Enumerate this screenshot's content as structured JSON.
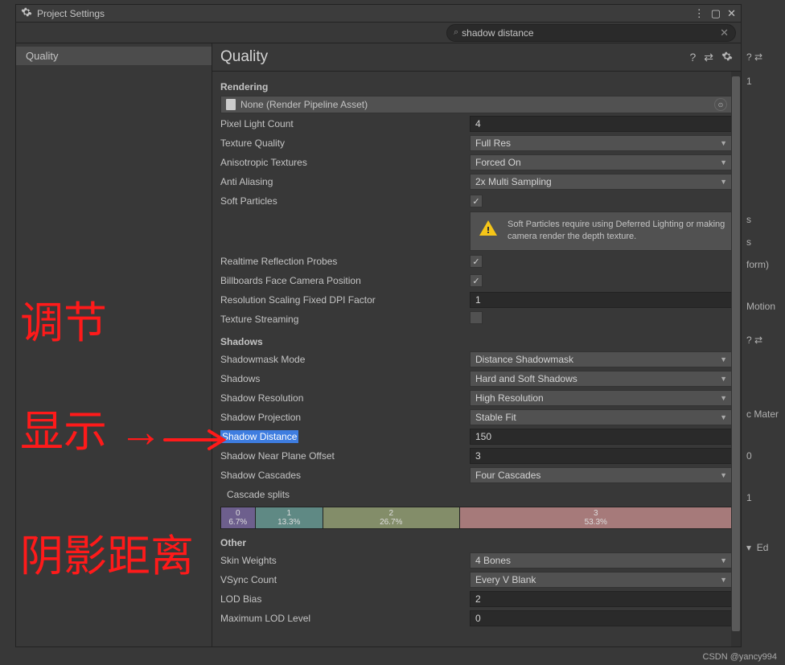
{
  "window": {
    "title": "Project Settings"
  },
  "search": {
    "placeholder": "",
    "value": "shadow distance"
  },
  "sidebar": {
    "items": [
      {
        "label": "Quality",
        "active": true
      }
    ]
  },
  "header": {
    "title": "Quality"
  },
  "sections": {
    "rendering": {
      "title": "Rendering",
      "pipeline_asset": "None (Render Pipeline Asset)",
      "pixel_light_count_label": "Pixel Light Count",
      "pixel_light_count": "4",
      "texture_quality_label": "Texture Quality",
      "texture_quality": "Full Res",
      "anisotropic_label": "Anisotropic Textures",
      "anisotropic": "Forced On",
      "antialiasing_label": "Anti Aliasing",
      "antialiasing": "2x Multi Sampling",
      "soft_particles_label": "Soft Particles",
      "soft_particles": true,
      "soft_particles_warning": "Soft Particles require using Deferred Lighting or making camera render the depth texture.",
      "realtime_probes_label": "Realtime Reflection Probes",
      "realtime_probes": true,
      "billboards_label": "Billboards Face Camera Position",
      "billboards": true,
      "resolution_scaling_label": "Resolution Scaling Fixed DPI Factor",
      "resolution_scaling": "1",
      "texture_streaming_label": "Texture Streaming",
      "texture_streaming": false
    },
    "shadows": {
      "title": "Shadows",
      "shadowmask_mode_label": "Shadowmask Mode",
      "shadowmask_mode": "Distance Shadowmask",
      "shadows_label": "Shadows",
      "shadows": "Hard and Soft Shadows",
      "shadow_resolution_label": "Shadow Resolution",
      "shadow_resolution": "High Resolution",
      "shadow_projection_label": "Shadow Projection",
      "shadow_projection": "Stable Fit",
      "shadow_distance_label": "Shadow Distance",
      "shadow_distance": "150",
      "shadow_near_label": "Shadow Near Plane Offset",
      "shadow_near": "3",
      "shadow_cascades_label": "Shadow Cascades",
      "shadow_cascades": "Four Cascades",
      "cascade_splits_label": "Cascade splits",
      "cascades": [
        {
          "index": "0",
          "pct": "6.7%"
        },
        {
          "index": "1",
          "pct": "13.3%"
        },
        {
          "index": "2",
          "pct": "26.7%"
        },
        {
          "index": "3",
          "pct": "53.3%"
        }
      ]
    },
    "other": {
      "title": "Other",
      "skin_weights_label": "Skin Weights",
      "skin_weights": "4 Bones",
      "vsync_label": "VSync Count",
      "vsync": "Every V Blank",
      "lod_bias_label": "LOD Bias",
      "lod_bias": "2",
      "max_lod_label": "Maximum LOD Level",
      "max_lod": "0"
    }
  },
  "bg_fragments": {
    "f1": "1",
    "f2": "s",
    "f3": "s",
    "f4": "form)",
    "f5": "Motion",
    "f6": "c Mater",
    "f7": "0",
    "f8": "1",
    "f9": "Ed"
  },
  "watermark": "CSDN @yancy994",
  "annotations": {
    "a1": "调节",
    "a2": "显示 →",
    "a3": "阴影距离"
  }
}
